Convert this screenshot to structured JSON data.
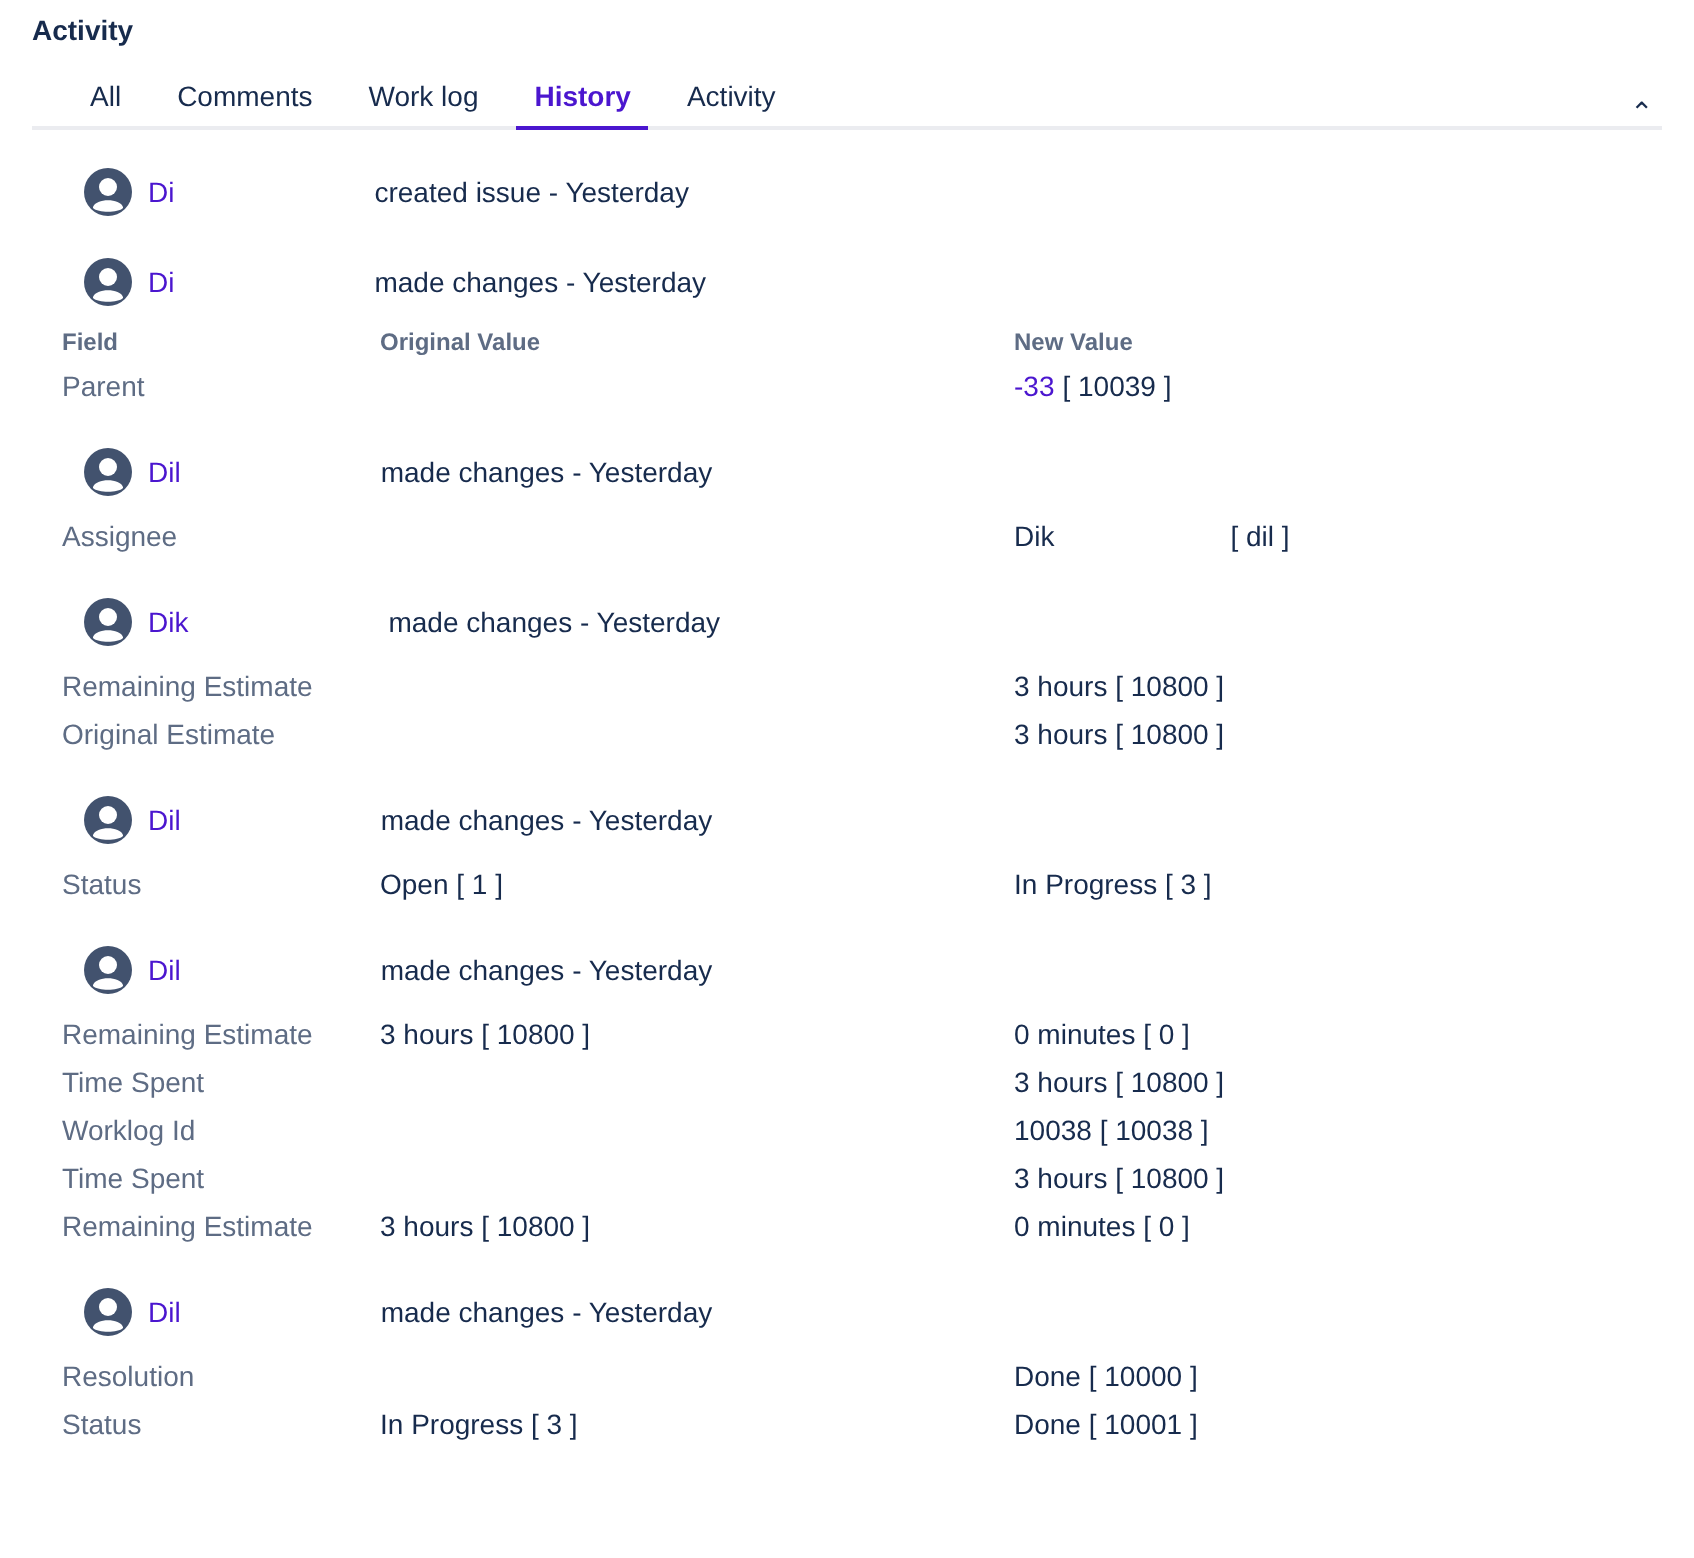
{
  "title": "Activity",
  "tabs": [
    {
      "label": "All",
      "selected": false
    },
    {
      "label": "Comments",
      "selected": false
    },
    {
      "label": "Work log",
      "selected": false
    },
    {
      "label": "History",
      "selected": true
    },
    {
      "label": "Activity",
      "selected": false
    }
  ],
  "collapse_icon": "⌃",
  "entries": [
    {
      "author": "Di",
      "action": "created issue - Yesterday"
    },
    {
      "author": "Di",
      "action": "made changes - Yesterday",
      "headings": {
        "field": "Field",
        "original": "Original Value",
        "new": "New Value"
      },
      "changes": [
        {
          "field": "Parent",
          "new_link": "-33",
          "new": "[ 10039 ]"
        }
      ]
    },
    {
      "author": "Dil",
      "action": "made changes - Yesterday",
      "changes": [
        {
          "field": "Assignee",
          "new_prefix": "Dik",
          "new": "[ dil ]"
        }
      ]
    },
    {
      "author": "Dik",
      "action": "made changes - Yesterday",
      "changes": [
        {
          "field": "Remaining Estimate",
          "new": "3 hours [ 10800 ]"
        },
        {
          "field": "Original Estimate",
          "new": "3 hours [ 10800 ]"
        }
      ]
    },
    {
      "author": "Dil",
      "action": "made changes - Yesterday",
      "changes": [
        {
          "field": "Status",
          "original": "Open [ 1 ]",
          "new": "In Progress [ 3 ]"
        }
      ]
    },
    {
      "author": "Dil",
      "action": "made changes - Yesterday",
      "changes": [
        {
          "field": "Remaining Estimate",
          "original": "3 hours [ 10800 ]",
          "new": "0 minutes [ 0 ]"
        },
        {
          "field": "Time Spent",
          "new": "3 hours [ 10800 ]"
        },
        {
          "field": "Worklog Id",
          "new": "10038 [ 10038 ]"
        },
        {
          "field": "Time Spent",
          "new": "3 hours [ 10800 ]"
        },
        {
          "field": "Remaining Estimate",
          "original": "3 hours [ 10800 ]",
          "new": "0 minutes [ 0 ]"
        }
      ]
    },
    {
      "author": "Dil",
      "action": "made changes - Yesterday",
      "changes": [
        {
          "field": "Resolution",
          "new": "Done [ 10000 ]"
        },
        {
          "field": "Status",
          "original": "In Progress [ 3 ]",
          "new": "Done [ 10001 ]"
        }
      ]
    }
  ]
}
